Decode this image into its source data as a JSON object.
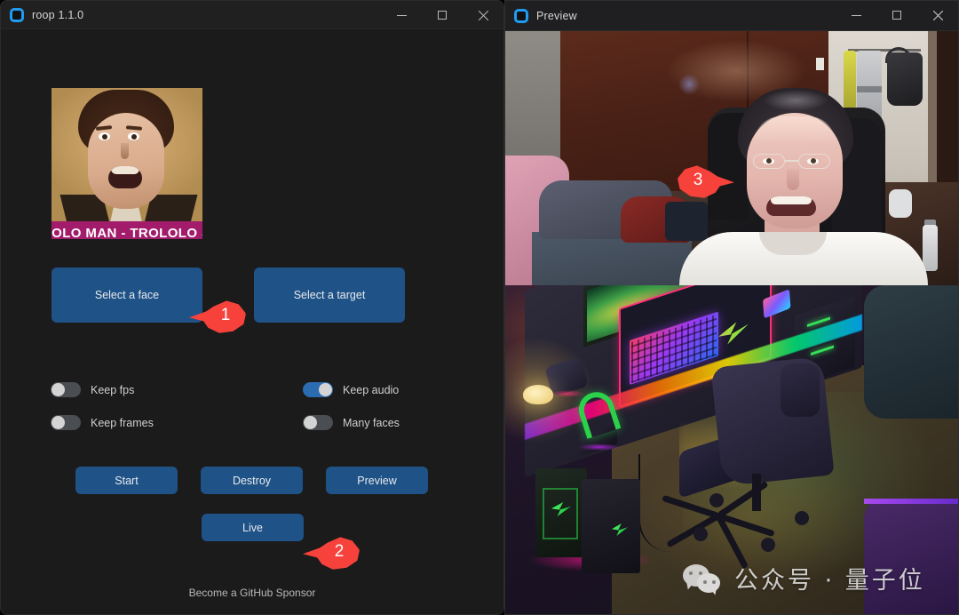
{
  "main_window": {
    "title": "roop 1.1.0",
    "icon": "app-logo-icon",
    "controls": {
      "minimize": "minimize-icon",
      "maximize": "maximize-icon",
      "close": "close-icon"
    },
    "face_preview": {
      "caption": "ROLOLO MAN - TROLOLO SON",
      "description": "Trololo man meme video frame used as source face"
    },
    "select_buttons": [
      {
        "label": "Select a face",
        "name": "select-face-button"
      },
      {
        "label": "Select a target",
        "name": "select-target-button"
      }
    ],
    "switches": [
      {
        "label": "Keep fps",
        "on": false,
        "name": "keep-fps-toggle"
      },
      {
        "label": "Keep audio",
        "on": true,
        "name": "keep-audio-toggle"
      },
      {
        "label": "Keep frames",
        "on": false,
        "name": "keep-frames-toggle"
      },
      {
        "label": "Many faces",
        "on": false,
        "name": "many-faces-toggle"
      }
    ],
    "action_buttons": [
      {
        "label": "Start",
        "name": "start-button"
      },
      {
        "label": "Destroy",
        "name": "destroy-button"
      },
      {
        "label": "Preview",
        "name": "preview-button"
      }
    ],
    "live_button": {
      "label": "Live",
      "name": "live-button"
    },
    "sponsor_link": "Become a GitHub Sponsor"
  },
  "preview_window": {
    "title": "Preview",
    "icon": "app-logo-icon",
    "controls": {
      "minimize": "minimize-icon",
      "maximize": "maximize-icon",
      "close": "close-icon"
    },
    "webcam_description": "Live webcam feed with swapped face: person wearing white t-shirt and headset in a bedroom with wooden door, pink couch and gaming chair",
    "wallpaper_description": "Isometric RGB gaming desk setup illustration with keyboard, monitor, headset stand, PC towers and gaming chair"
  },
  "watermark": {
    "text": "公众号 · 量子位",
    "logo": "wechat-icon"
  },
  "annotations": [
    {
      "number": "1",
      "name": "annotation-marker-1",
      "points_at": "select-face-button"
    },
    {
      "number": "2",
      "name": "annotation-marker-2",
      "points_at": "live-button"
    },
    {
      "number": "3",
      "name": "annotation-marker-3",
      "points_at": "preview-webcam-face"
    }
  ],
  "colors": {
    "window_bg": "#1b1b1b",
    "titlebar_bg": "#202020",
    "button_blue": "#1f5287",
    "accent_blue": "#1f9cf0",
    "toggle_on": "#2b6cb0",
    "toggle_off": "#4a4d52",
    "marker_red": "#f7423c",
    "caption_magenta": "#a31b6b",
    "text_primary": "#d6d6d6"
  }
}
